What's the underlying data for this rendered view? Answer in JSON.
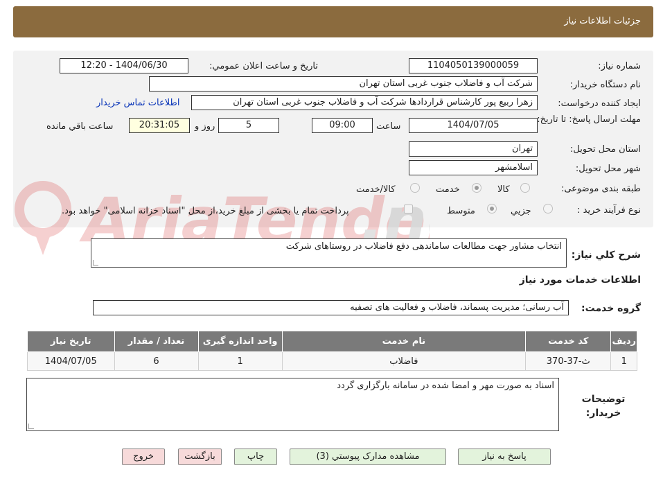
{
  "header": {
    "title": "جزئیات اطلاعات نیاز"
  },
  "form": {
    "need_number_label": "شماره نیاز:",
    "need_number": "1104050139000059",
    "announce_label": "تاریخ و ساعت اعلان عمومي:",
    "announce_value": "1404/06/30 - 12:20",
    "buyer_org_label": "نام دستگاه خريدار:",
    "buyer_org": "شرکت آب و فاضلاب جنوب غربی استان تهران",
    "requester_label": "ايجاد کننده درخواست:",
    "requester": "زهرا  ربیع پور کارشناس قراردادها  شرکت آب و فاضلاب جنوب غربی استان تهران",
    "contact_link": "اطلاعات تماس خريدار",
    "deadline_label": "مهلت ارسال پاسخ: تا تاریخ:",
    "deadline_date": "1404/07/05",
    "time_label": "ساعت",
    "deadline_time": "09:00",
    "days_value": "5",
    "days_label": "روز و",
    "remaining_time": "20:31:05",
    "remaining_label": "ساعت باقي مانده",
    "province_label": "استان محل تحویل:",
    "province": "تهران",
    "city_label": "شهر محل تحویل:",
    "city": "اسلامشهر",
    "category_label": "طبقه بندی موضوعی:",
    "category_options": [
      "کالا",
      "خدمت",
      "کالا/خدمت"
    ],
    "process_label": "نوع فرآیند خرید :",
    "process_options": [
      "جزيي",
      "متوسط"
    ],
    "payment_note": "پرداخت تمام یا بخشی از مبلغ خرید،از محل \"اسناد خزانه اسلامی\" خواهد بود."
  },
  "description": {
    "label": "شرح کلي نياز:",
    "value": "انتخاب مشاور جهت مطالعات ساماندهی دفع فاضلاب در روستاهای شرکت"
  },
  "services": {
    "section_title": "اطلاعات خدمات مورد نياز",
    "group_label": "گروه خدمت:",
    "group_value": "آب رسانی؛ مدیریت پسماند، فاضلاب و فعالیت های تصفیه",
    "columns": [
      "رديف",
      "کد خدمت",
      "نام خدمت",
      "واحد اندازه گيری",
      "تعداد / مقدار",
      "تاريخ نياز"
    ],
    "rows": [
      [
        "1",
        "ث-37-370",
        "فاضلاب",
        "1",
        "6",
        "1404/07/05"
      ]
    ]
  },
  "buyer_notes": {
    "label": "توضيحات خريدار:",
    "value": "اسناد به صورت مهر و امضا شده در سامانه بارگزاری گردد"
  },
  "buttons": {
    "reply": "پاسخ به نياز",
    "attachments": "مشاهده مدارک پيوستي (3)",
    "print": "چاپ",
    "back": "بازگشت",
    "exit": "خروج"
  },
  "colors": {
    "header_bg": "#8b6b3e",
    "link": "#0a35b8",
    "table_header": "#7a7a7a",
    "green_button": "#e3f3dc",
    "pink_button": "#f7dada"
  }
}
